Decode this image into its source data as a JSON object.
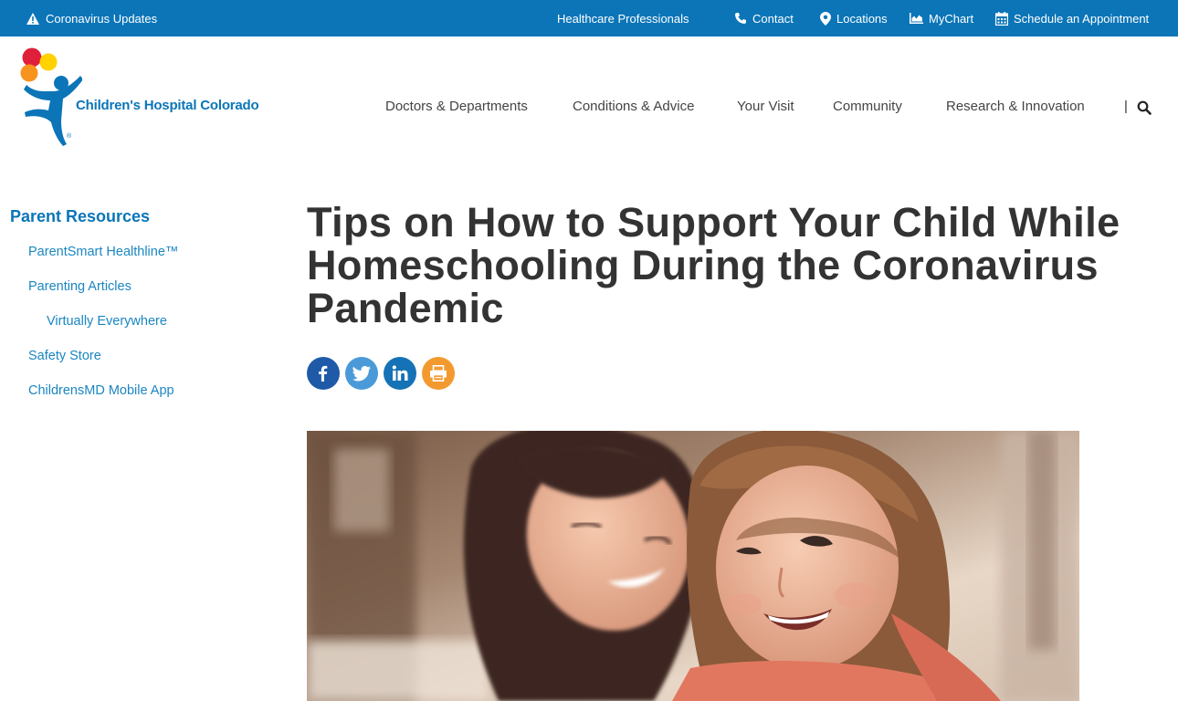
{
  "topbar": {
    "alert_label": "Coronavirus Updates",
    "healthcare_label": "Healthcare Professionals",
    "contact_label": "Contact",
    "locations_label": "Locations",
    "mychart_label": "MyChart",
    "schedule_label": "Schedule an Appointment",
    "background_color": "#0b75b8"
  },
  "header": {
    "logo_text": "Children's Hospital Colorado",
    "logo_mark": "®",
    "nav": [
      {
        "label": "Doctors & Departments"
      },
      {
        "label": "Conditions & Advice"
      },
      {
        "label": "Your Visit"
      },
      {
        "label": "Community"
      },
      {
        "label": "Research & Innovation"
      }
    ],
    "separator": "|",
    "search_icon": "search-icon"
  },
  "sidebar": {
    "title": "Parent Resources",
    "items": [
      {
        "label": "ParentSmart Healthline™"
      },
      {
        "label": "Parenting Articles"
      },
      {
        "label": "Virtually Everywhere"
      },
      {
        "label": "Safety Store"
      },
      {
        "label": "ChildrensMD Mobile App"
      }
    ]
  },
  "article": {
    "title": "Tips on How to Support Your Child While Homeschooling During the Coronavirus Pandemic",
    "share": [
      {
        "icon": "facebook-icon",
        "color": "#1e5aa8"
      },
      {
        "icon": "twitter-icon",
        "color": "#4a9ad9"
      },
      {
        "icon": "linkedin-icon",
        "color": "#1572b6"
      },
      {
        "icon": "print-icon",
        "color": "#f39a2f"
      }
    ]
  },
  "colors": {
    "brand_blue": "#0b75b8",
    "link_blue": "#1a86c1",
    "heading_text": "#333333"
  }
}
